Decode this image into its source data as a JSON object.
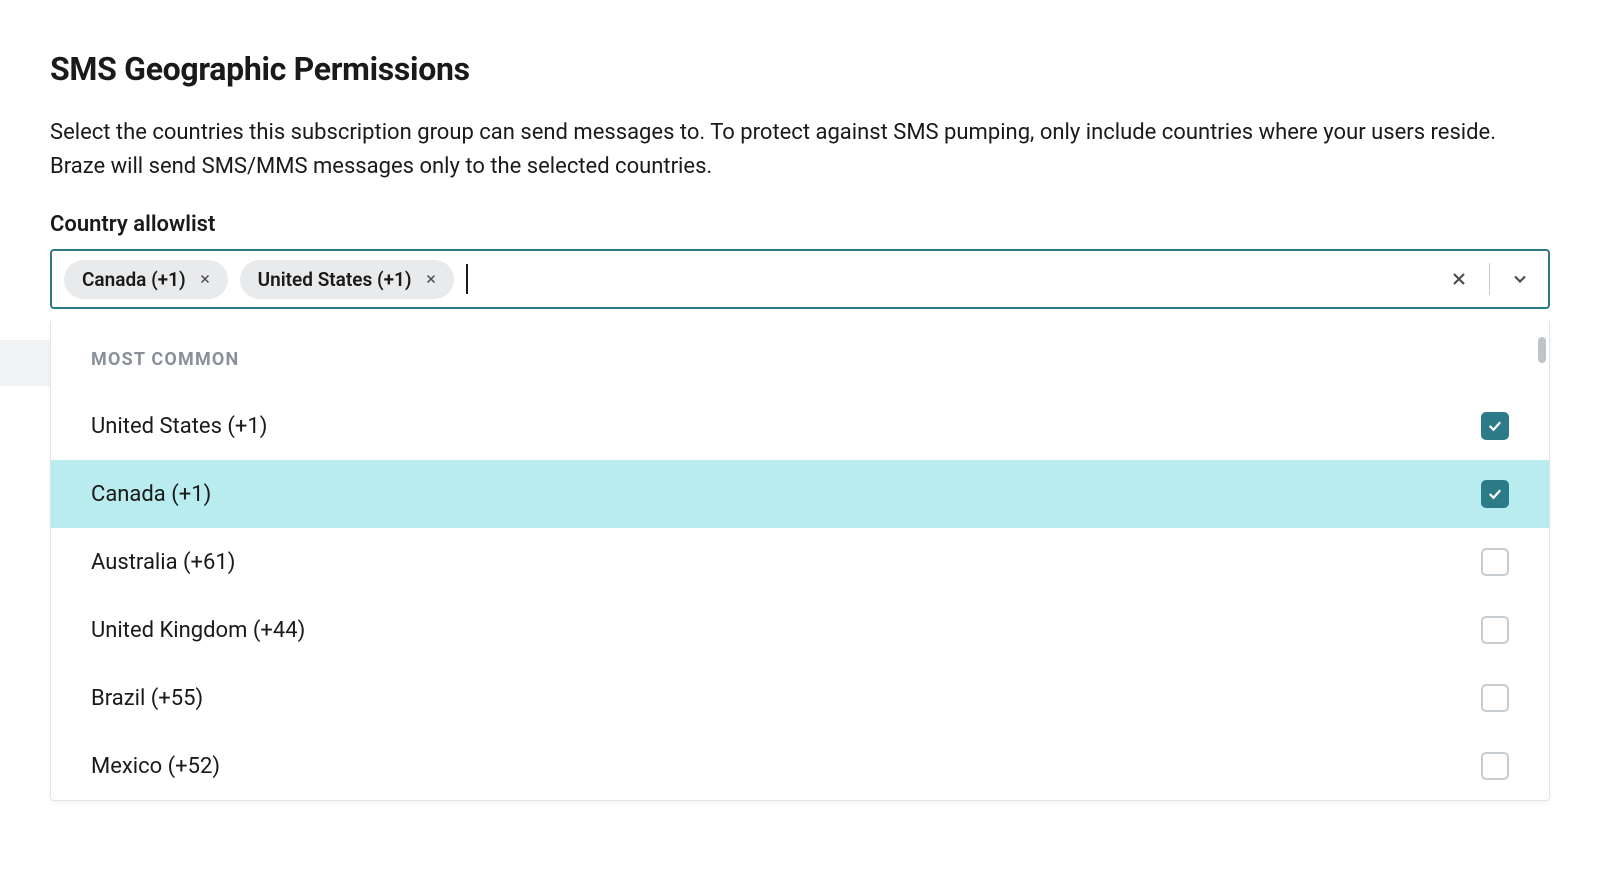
{
  "header": {
    "title": "SMS Geographic Permissions",
    "description": "Select the countries this subscription group can send messages to. To protect against SMS pumping, only include countries where your users reside. Braze will send SMS/MMS messages only to the selected countries.",
    "field_label": "Country allowlist"
  },
  "selected": [
    {
      "label": "Canada (+1)"
    },
    {
      "label": "United States (+1)"
    }
  ],
  "dropdown": {
    "group_header": "Most Common",
    "options": [
      {
        "label": "United States (+1)",
        "checked": true,
        "highlighted": false
      },
      {
        "label": "Canada (+1)",
        "checked": true,
        "highlighted": true
      },
      {
        "label": "Australia (+61)",
        "checked": false,
        "highlighted": false
      },
      {
        "label": "United Kingdom (+44)",
        "checked": false,
        "highlighted": false
      },
      {
        "label": "Brazil (+55)",
        "checked": false,
        "highlighted": false
      },
      {
        "label": "Mexico (+52)",
        "checked": false,
        "highlighted": false
      }
    ]
  }
}
